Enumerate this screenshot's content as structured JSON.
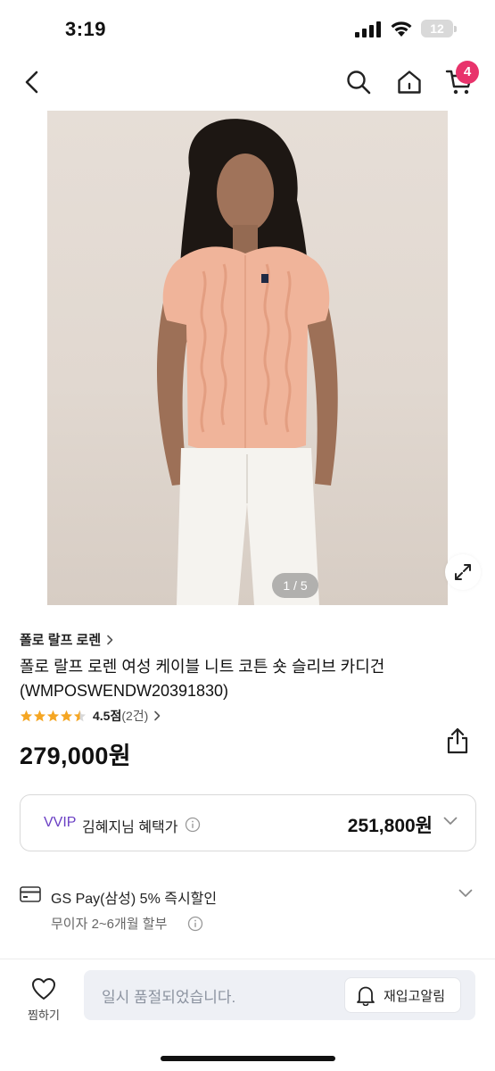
{
  "status_bar": {
    "time": "3:19",
    "battery": "12"
  },
  "top_nav": {
    "cart_count": "4",
    "icons": [
      "chevron-left-icon",
      "search-icon",
      "home-icon",
      "cart-icon"
    ]
  },
  "gallery": {
    "page_indicator": "1 / 5",
    "current_page": 1,
    "total_pages": 5
  },
  "product": {
    "brand": "폴로 랄프 로렌",
    "title_line1": "폴로 랄프 로렌 여성 케이블 니트 코튼 숏 슬리브 카디건",
    "title_line2": "(WMPOSWENDW20391830)",
    "rating_score": "4.5점",
    "rating_count": "(2건)",
    "rating_value": 4.5,
    "rating_max": 5,
    "price": "279,000원"
  },
  "member_price": {
    "tier": "VVIP",
    "label": "김혜지님 혜택가",
    "price": "251,800원"
  },
  "payment": {
    "promo": "GS Pay(삼성) 5% 즉시할인",
    "installment": "무이자 2~6개월 할부"
  },
  "bottom_bar": {
    "wish_label": "찜하기",
    "soldout_text": "일시 품절되었습니다.",
    "restock_label": "재입고알림"
  },
  "colors": {
    "badge": "#e8336b",
    "vip": "#6a3fc4",
    "star": "#f5a623",
    "soldout_bg": "#eef0f5"
  }
}
